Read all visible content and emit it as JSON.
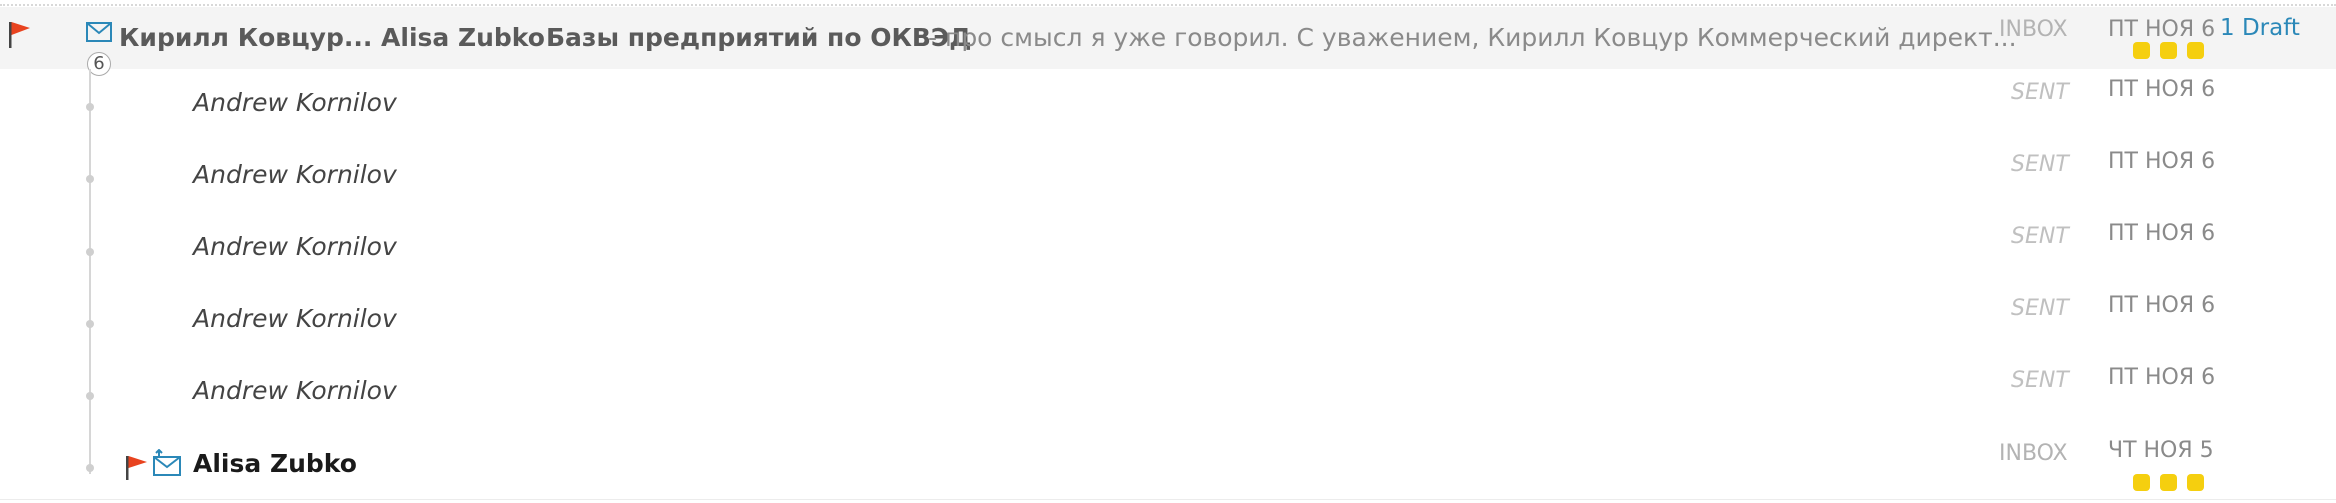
{
  "thread": {
    "senders": "Кирилл Ковцур... Alisa Zubko",
    "subject": "Базы предприятий по ОКВЭД",
    "snippet": "- про смысл я уже говорил. С уважением, Кирилл Ковцур Коммерческий директ...",
    "count": "6",
    "folder": "INBOX",
    "date": "ПТ НОЯ 6",
    "draft": "1 Draft"
  },
  "messages": [
    {
      "sender": "Andrew Kornilov",
      "folder": "SENT",
      "date": "ПТ НОЯ 6"
    },
    {
      "sender": "Andrew Kornilov",
      "folder": "SENT",
      "date": "ПТ НОЯ 6"
    },
    {
      "sender": "Andrew Kornilov",
      "folder": "SENT",
      "date": "ПТ НОЯ 6"
    },
    {
      "sender": "Andrew Kornilov",
      "folder": "SENT",
      "date": "ПТ НОЯ 6"
    },
    {
      "sender": "Andrew Kornilov",
      "folder": "SENT",
      "date": "ПТ НОЯ 6"
    },
    {
      "sender": "Alisa Zubko",
      "folder": "INBOX",
      "date": "ЧТ НОЯ 5"
    }
  ],
  "icons": {
    "flag": "flag-icon",
    "envelope": "envelope-icon",
    "reply_envelope": "envelope-reply-icon",
    "label_dots": "label-dots"
  },
  "colors": {
    "flag": "#e8431f",
    "envelope": "#2b88b8",
    "label_dot": "#f5cf0f",
    "draft_link": "#2b88b8"
  }
}
